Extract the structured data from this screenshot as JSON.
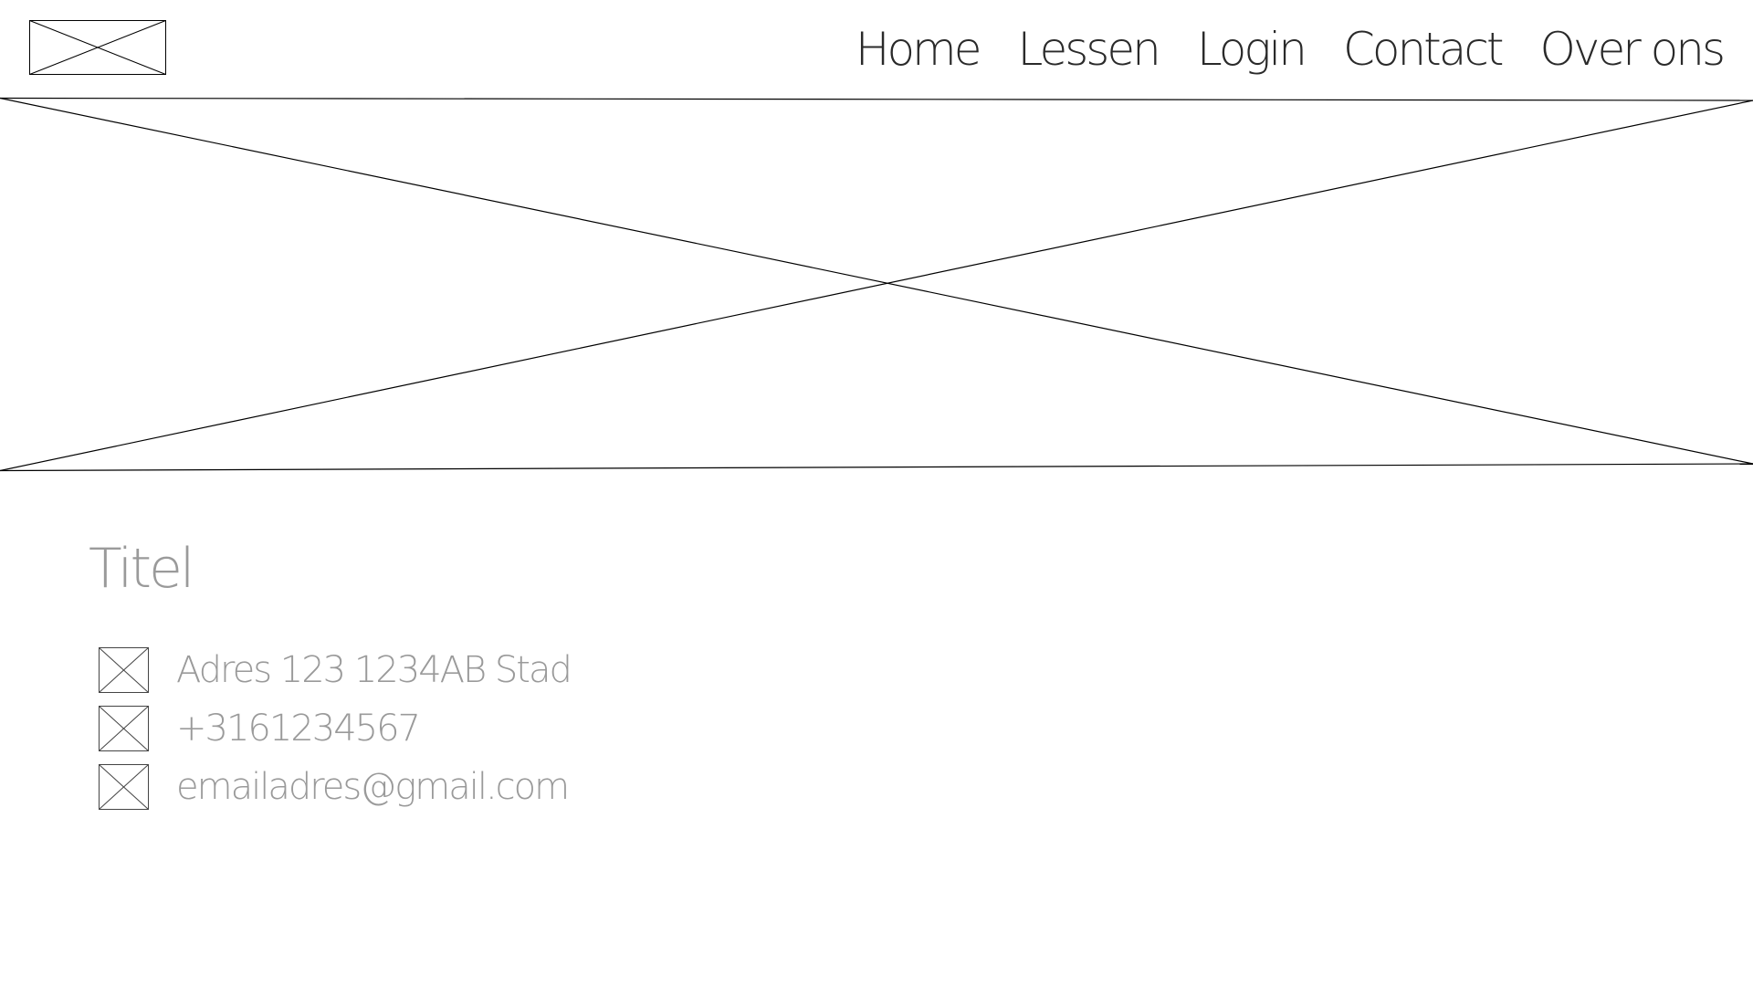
{
  "header": {
    "logo_icon": "image-placeholder-icon",
    "nav": {
      "home": "Home",
      "lessen": "Lessen",
      "login": "Login",
      "contact": "Contact",
      "over_ons": "Over ons"
    }
  },
  "hero": {
    "icon": "image-placeholder-icon"
  },
  "main": {
    "title": "Titel",
    "contact": {
      "address": {
        "icon": "image-placeholder-icon",
        "text": "Adres 123 1234AB  Stad"
      },
      "phone": {
        "icon": "image-placeholder-icon",
        "text": "+3161234567"
      },
      "email": {
        "icon": "image-placeholder-icon",
        "text": "emailadres@gmail.com"
      }
    }
  },
  "colors": {
    "line": "#000000",
    "nav_text": "#2a2a2a",
    "muted_text": "#9a9a9a",
    "background": "#ffffff"
  }
}
